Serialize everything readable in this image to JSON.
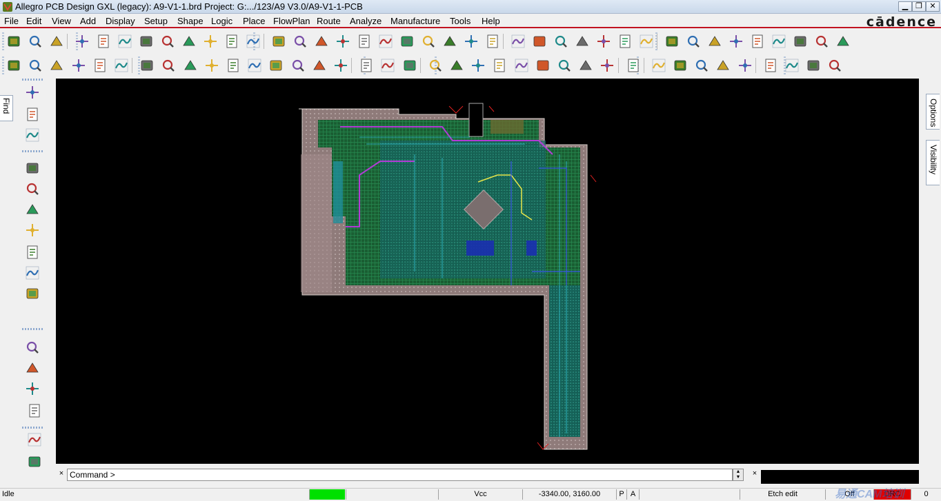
{
  "window": {
    "title": "Allegro PCB Design GXL (legacy): A9-V1-1.brd  Project: G:.../123/A9 V3.0/A9-V1-1-PCB",
    "minimize": "▁",
    "restore": "❐",
    "close": "✕"
  },
  "menu": {
    "items": [
      "File",
      "Edit",
      "View",
      "Add",
      "Display",
      "Setup",
      "Shape",
      "Logic",
      "Place",
      "FlowPlan",
      "Route",
      "Analyze",
      "Manufacture",
      "Tools",
      "Help"
    ],
    "logo": "cādence"
  },
  "panels": {
    "find_tab": "Find",
    "options_tab": "Options",
    "visibility_tab": "Visibility"
  },
  "command": {
    "prompt": "Command >",
    "close": "×"
  },
  "status": {
    "state": "Idle",
    "net": "Vcc",
    "coordinates": "-3340.00, 3160.00",
    "p": "P",
    "a": "A",
    "mode": "Etch edit",
    "drc_toggle": "Off",
    "drc": "DRC",
    "count": "0"
  },
  "watermark": "易通CAM培训",
  "colors": {
    "menu_accent": "#c2121f",
    "canvas_background": "#000000",
    "status_green": "#00e000",
    "status_red": "#e00000"
  },
  "icons": {
    "toolbar1": [
      "new-file-icon",
      "open-folder-icon",
      "save-icon",
      "move-icon",
      "copy-icon",
      "delete-icon",
      "undo-icon",
      "redo-icon",
      "redo-history-icon",
      "redo-step-icon",
      "shape-fill-icon",
      "pin-icon",
      "zoom-fit-icon",
      "grid-icon",
      "zoom-points-icon",
      "zoom-in-icon",
      "zoom-in-plus-icon",
      "zoom-out-icon",
      "zoom-previous-icon",
      "zoom-world-icon",
      "refresh-icon",
      "3d-view-icon",
      "flip-board-icon",
      "grid-toggle-icon",
      "color-icon",
      "layer-icon",
      "stackup-icon",
      "cm-icon",
      "dfa-icon",
      "web-icon",
      "info-icon",
      "property-icon",
      "measure-icon",
      "pick-icon",
      "light-icon",
      "settings-icon",
      "report-icon",
      "hourglass-icon",
      "highlight-icon"
    ],
    "toolbar2": [
      "select-group-icon",
      "select-red-icon",
      "select-box-icon",
      "select-net-icon",
      "select-comp-icon",
      "gray-box-icon",
      "add-line-icon",
      "add-rect-icon",
      "add-circle-icon",
      "pointer-icon",
      "shape-edit-icon",
      "shape-merge-icon",
      "shape-square-icon",
      "shape-circle-icon",
      "shape-void-icon",
      "shape-delete-icon",
      "constraint-icon",
      "dimension-icon",
      "distance-icon",
      "odb-icon",
      "prop-icon",
      "via-icon",
      "camera-icon",
      "textbox-icon",
      "tag-icon",
      "pad-icon",
      "wand-icon",
      "grid-dots-icon",
      "waveform-icon",
      "clipboard-icon",
      "book-icon",
      "check-icon",
      "checkmark-icon",
      "route-icon",
      "copy-layers-icon",
      "envelope-icon",
      "mail-icon",
      "help-icon"
    ],
    "left": [
      "add-connect-icon",
      "slide-icon",
      "fanout-icon",
      "delay-tune-icon",
      "custom-smooth-icon",
      "spread-icon",
      "bus-icon",
      "arc-icon",
      "wave-icon",
      "line-icon",
      "rect-icon",
      "add-text-icon",
      "edit-text-icon",
      "connect-route-icon",
      "route-icon-2",
      "delete-route-icon"
    ]
  }
}
